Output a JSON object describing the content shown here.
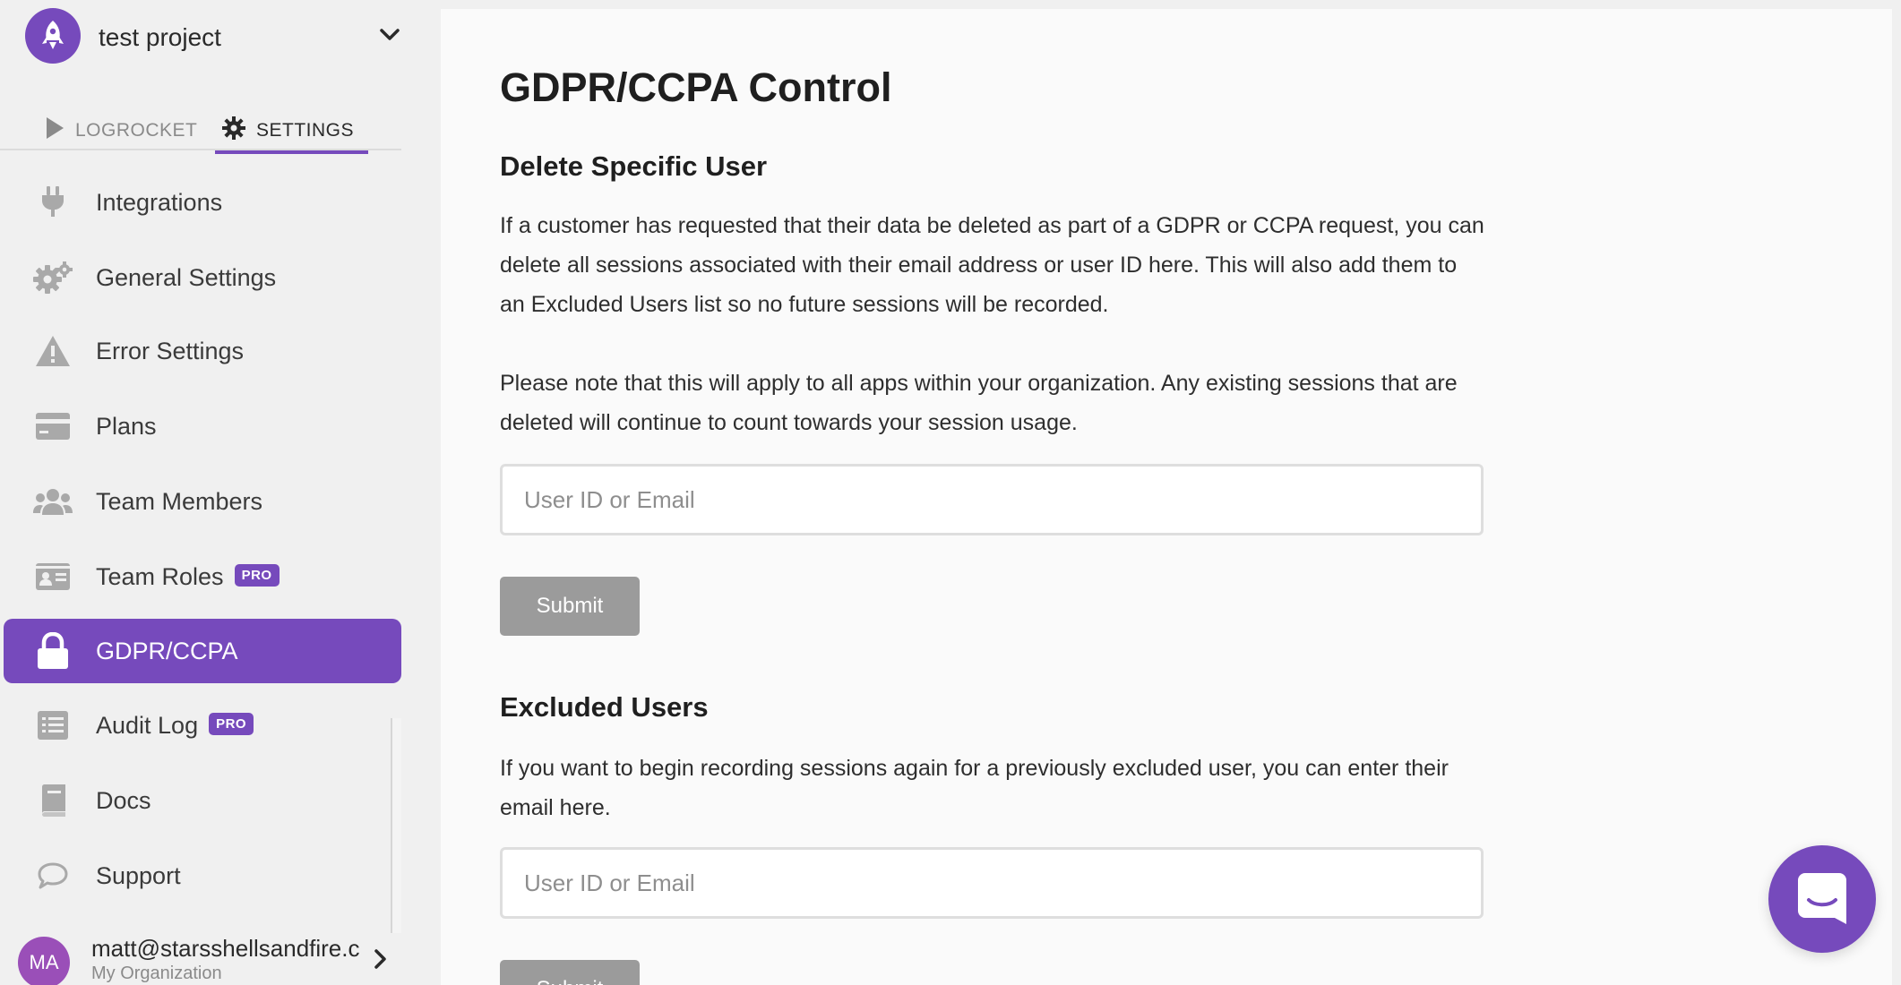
{
  "project": {
    "name": "test project"
  },
  "top_tabs": {
    "logrocket": "LOGROCKET",
    "settings": "SETTINGS"
  },
  "nav": {
    "items": [
      {
        "label": "Integrations",
        "icon": "plug-icon"
      },
      {
        "label": "General Settings",
        "icon": "gears-icon"
      },
      {
        "label": "Error Settings",
        "icon": "warning-icon"
      },
      {
        "label": "Plans",
        "icon": "credit-card-icon"
      },
      {
        "label": "Team Members",
        "icon": "users-icon"
      },
      {
        "label": "Team Roles",
        "icon": "id-card-icon",
        "badge": "PRO"
      },
      {
        "label": "GDPR/CCPA",
        "icon": "lock-icon",
        "active": true
      },
      {
        "label": "Audit Log",
        "icon": "list-icon",
        "badge": "PRO"
      },
      {
        "label": "Docs",
        "icon": "book-icon"
      },
      {
        "label": "Support",
        "icon": "chat-bubble-icon"
      }
    ]
  },
  "user": {
    "initials": "MA",
    "email": "matt@starsshellsandfire.c",
    "org": "My Organization"
  },
  "main": {
    "title": "GDPR/CCPA Control",
    "delete_section": {
      "title": "Delete Specific User",
      "para1": "If a customer has requested that their data be deleted as part of a GDPR or CCPA request, you can delete all sessions associated with their email address or user ID here. This will also add them to an Excluded Users list so no future sessions will be recorded.",
      "para2": "Please note that this will apply to all apps within your organization. Any existing sessions that are deleted will continue to count towards your session usage.",
      "input_placeholder": "User ID or Email",
      "input_value": "",
      "submit_label": "Submit"
    },
    "excluded_section": {
      "title": "Excluded Users",
      "para": "If you want to begin recording sessions again for a previously excluded user, you can enter their email here.",
      "input_placeholder": "User ID or Email",
      "input_value": "",
      "submit_label": "Submit"
    }
  },
  "colors": {
    "brand": "#764abc",
    "active_nav": "#764abc",
    "submit_disabled": "#9b9b9b",
    "avatar": "#9a4fb8"
  }
}
